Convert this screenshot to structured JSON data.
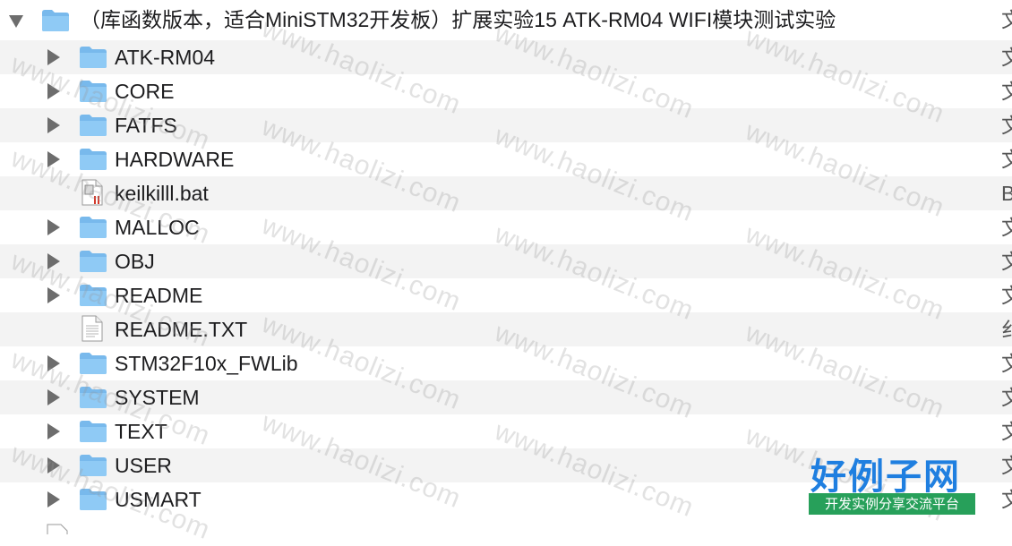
{
  "root": {
    "name": "（库函数版本，适合MiniSTM32开发板）扩展实验15 ATK-RM04 WIFI模块测试实验",
    "kind": "文",
    "icon": "folder-icon",
    "expanded": true
  },
  "items": [
    {
      "name": "ATK-RM04",
      "kind": "文",
      "icon": "folder-icon"
    },
    {
      "name": "CORE",
      "kind": "文",
      "icon": "folder-icon"
    },
    {
      "name": "FATFS",
      "kind": "文",
      "icon": "folder-icon"
    },
    {
      "name": "HARDWARE",
      "kind": "文",
      "icon": "folder-icon"
    },
    {
      "name": "keilkilll.bat",
      "kind": "B",
      "icon": "bat-file-icon"
    },
    {
      "name": "MALLOC",
      "kind": "文",
      "icon": "folder-icon"
    },
    {
      "name": "OBJ",
      "kind": "文",
      "icon": "folder-icon"
    },
    {
      "name": "README",
      "kind": "文",
      "icon": "folder-icon"
    },
    {
      "name": "README.TXT",
      "kind": "纟",
      "icon": "text-file-icon"
    },
    {
      "name": "STM32F10x_FWLib",
      "kind": "文",
      "icon": "folder-icon"
    },
    {
      "name": "SYSTEM",
      "kind": "文",
      "icon": "folder-icon"
    },
    {
      "name": "TEXT",
      "kind": "文",
      "icon": "folder-icon"
    },
    {
      "name": "USER",
      "kind": "文",
      "icon": "folder-icon"
    },
    {
      "name": "USMART",
      "kind": "文",
      "icon": "folder-icon"
    }
  ],
  "watermark": "www.haolizi.com",
  "brand": {
    "title": "好例子网",
    "subtitle": "开发实例分享交流平台",
    "title_color": "#1f7fe0",
    "subtitle_bg": "#27a05a"
  },
  "colors": {
    "folder": "#8fcaf5",
    "folder_tab": "#78b9ec",
    "row_alt": "#f3f3f3"
  }
}
